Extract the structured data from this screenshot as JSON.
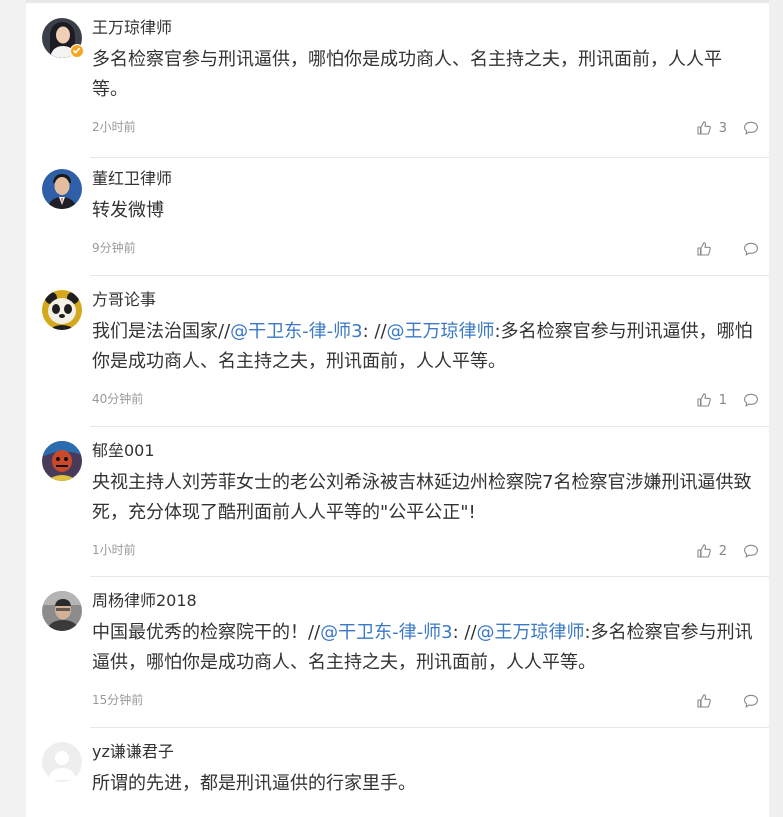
{
  "comments": [
    {
      "author": "王万琼律师",
      "verified": true,
      "segments": [
        {
          "t": "多名检察官参与刑讯逼供，哪怕你是成功商人、名主持之夫，刑讯面前，人人平等。",
          "m": false
        }
      ],
      "time": "2小时前",
      "likes": "3"
    },
    {
      "author": "董红卫律师",
      "verified": false,
      "segments": [
        {
          "t": "转发微博",
          "m": false
        }
      ],
      "time": "9分钟前",
      "likes": ""
    },
    {
      "author": "方哥论事",
      "verified": false,
      "segments": [
        {
          "t": "我们是法治国家//",
          "m": false
        },
        {
          "t": "@干卫东-律-师3",
          "m": true
        },
        {
          "t": ": //",
          "m": false
        },
        {
          "t": "@王万琼律师",
          "m": true
        },
        {
          "t": ":多名检察官参与刑讯逼供，哪怕你是成功商人、名主持之夫，刑讯面前，人人平等。",
          "m": false
        }
      ],
      "time": "40分钟前",
      "likes": "1"
    },
    {
      "author": "郁垒001",
      "verified": false,
      "segments": [
        {
          "t": "央视主持人刘芳菲女士的老公刘希泳被吉林延边州检察院7名检察官涉嫌刑讯逼供致死，充分体现了酷刑面前人人平等的\"公平公正\"!",
          "m": false
        }
      ],
      "time": "1小时前",
      "likes": "2"
    },
    {
      "author": "周杨律师2018",
      "verified": false,
      "segments": [
        {
          "t": "中国最优秀的检察院干的！//",
          "m": false
        },
        {
          "t": "@干卫东-律-师3",
          "m": true
        },
        {
          "t": ": //",
          "m": false
        },
        {
          "t": "@王万琼律师",
          "m": true
        },
        {
          "t": ":多名检察官参与刑讯逼供，哪怕你是成功商人、名主持之夫，刑讯面前，人人平等。",
          "m": false
        }
      ],
      "time": "15分钟前",
      "likes": ""
    },
    {
      "author": "yz谦谦君子",
      "verified": false,
      "segments": [
        {
          "t": "所谓的先进，都是刑讯逼供的行家里手。",
          "m": false
        }
      ],
      "time": "",
      "likes": ""
    }
  ],
  "icons": {
    "like": "thumbs-up-icon",
    "reply": "comment-bubble-icon",
    "verified": "verified-badge-icon"
  },
  "colors": {
    "mention": "#3b79c4",
    "verified": "#f6a623",
    "meta": "#999999"
  }
}
